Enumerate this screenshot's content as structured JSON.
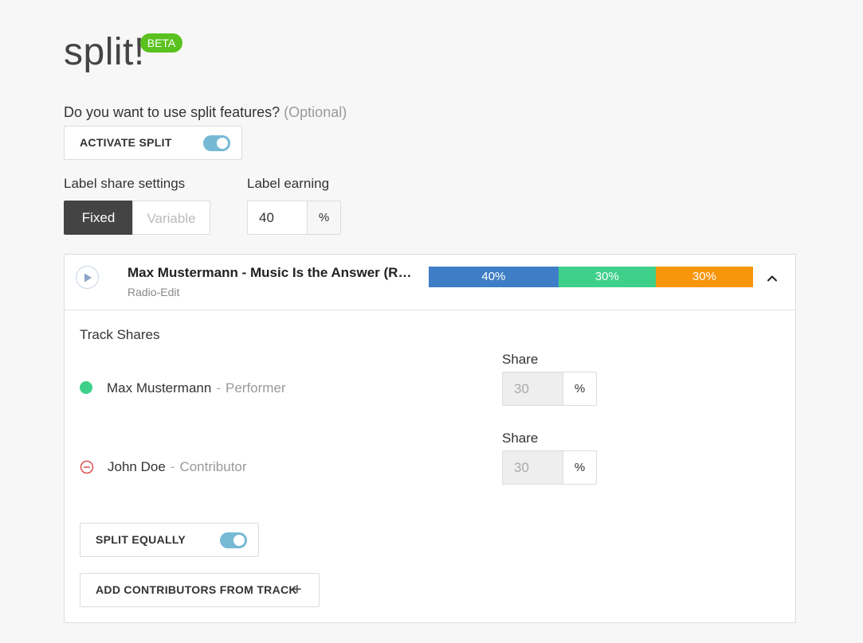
{
  "header": {
    "title": "split!",
    "badge": "BETA"
  },
  "activate": {
    "question": "Do you want to use split features?",
    "optional": "(Optional)",
    "label": "ACTIVATE SPLIT",
    "on": true
  },
  "label_share": {
    "label": "Label share settings",
    "options": [
      "Fixed",
      "Variable"
    ],
    "selected": "Fixed"
  },
  "label_earning": {
    "label": "Label earning",
    "value": "40",
    "unit": "%"
  },
  "track": {
    "title": "Max Mustermann - Music Is the Answer (Radio-Edit)",
    "subtitle": "Radio-Edit",
    "shares": [
      {
        "label": "40%",
        "value": 40,
        "color": "#3f7ec6"
      },
      {
        "label": "30%",
        "value": 30,
        "color": "#3ed08a"
      },
      {
        "label": "30%",
        "value": 30,
        "color": "#f7950b"
      }
    ]
  },
  "track_shares": {
    "heading": "Track Shares",
    "rows": [
      {
        "name": "Max Mustermann",
        "separator": "-",
        "role": "Performer",
        "share_label": "Share",
        "value": "30",
        "unit": "%",
        "dot_color": "#3ed08a"
      },
      {
        "name": "John Doe",
        "separator": "-",
        "role": "Contributor",
        "share_label": "Share",
        "value": "30",
        "unit": "%",
        "remove_color": "#d9534f"
      }
    ]
  },
  "split_equally": {
    "label": "SPLIT EQUALLY",
    "on": true
  },
  "add_contributors": {
    "label": "ADD CONTRIBUTORS FROM TRACK",
    "icon": "plus-icon"
  }
}
